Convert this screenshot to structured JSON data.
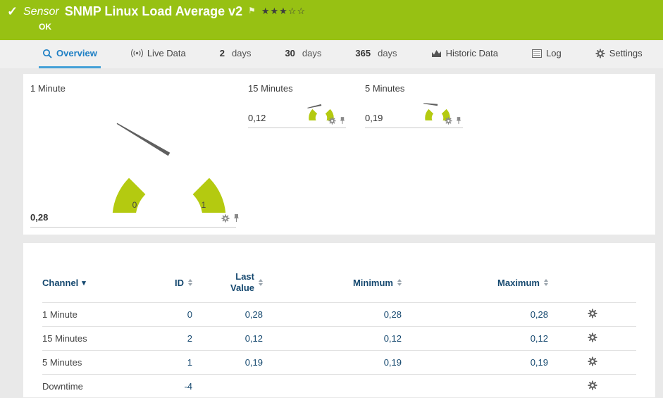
{
  "colors": {
    "header_green": "#97c113",
    "gauge_green": "#b4ca10",
    "tab_active_blue": "#1d7fc4",
    "table_navy": "#15486f"
  },
  "header": {
    "kind_label": "Sensor",
    "title": "SNMP Linux Load Average v2",
    "status": "OK",
    "rating_display": "★★★☆☆"
  },
  "tabs": {
    "overview": {
      "label": "Overview"
    },
    "live_data": {
      "label": "Live Data"
    },
    "d2": {
      "num": "2",
      "unit": "days"
    },
    "d30": {
      "num": "30",
      "unit": "days"
    },
    "d365": {
      "num": "365",
      "unit": "days"
    },
    "historic": {
      "label": "Historic Data"
    },
    "log": {
      "label": "Log"
    },
    "settings": {
      "label": "Settings"
    }
  },
  "gauges": [
    {
      "label": "1 Minute",
      "value_display": "0,28",
      "value": 0.28,
      "scale_min": "0",
      "scale_max": "1"
    },
    {
      "label": "15 Minutes",
      "value_display": "0,12",
      "value": 0.12
    },
    {
      "label": "5 Minutes",
      "value_display": "0,19",
      "value": 0.19
    }
  ],
  "table": {
    "headers": {
      "channel": "Channel",
      "id": "ID",
      "last_value": "Last Value",
      "minimum": "Minimum",
      "maximum": "Maximum"
    },
    "rows": [
      {
        "channel": "1 Minute",
        "id": "0",
        "last": "0,28",
        "min": "0,28",
        "max": "0,28"
      },
      {
        "channel": "15 Minutes",
        "id": "2",
        "last": "0,12",
        "min": "0,12",
        "max": "0,12"
      },
      {
        "channel": "5 Minutes",
        "id": "1",
        "last": "0,19",
        "min": "0,19",
        "max": "0,19"
      },
      {
        "channel": "Downtime",
        "id": "-4",
        "last": "",
        "min": "",
        "max": ""
      }
    ]
  }
}
